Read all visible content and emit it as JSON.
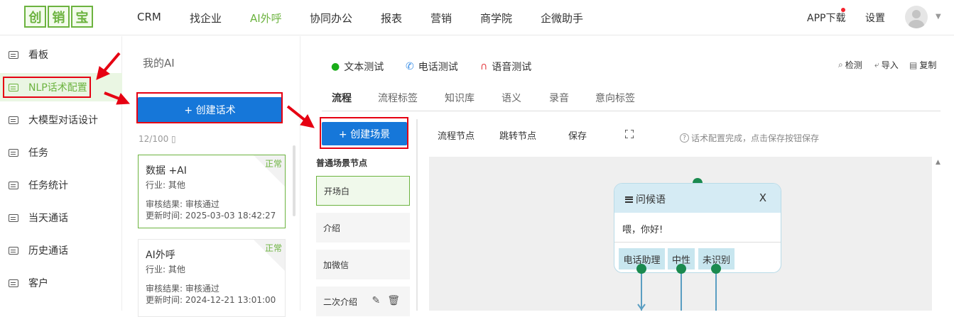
{
  "brand": {
    "logo_chars": [
      "创",
      "销",
      "宝"
    ]
  },
  "nav": {
    "items": [
      "CRM",
      "找企业",
      "AI外呼",
      "协同办公",
      "报表",
      "营销",
      "商学院",
      "企微助手"
    ],
    "active": "AI外呼",
    "app_download": "APP下载",
    "settings": "设置"
  },
  "sidebar": {
    "items": [
      "看板",
      "NLP话术配置",
      "大模型对话设计",
      "任务",
      "任务统计",
      "当天通话",
      "历史通话",
      "客户"
    ],
    "active": "NLP话术配置"
  },
  "ai_panel": {
    "title": "我的AI",
    "create_button": "+ 创建话术",
    "count": "12/100 ▯",
    "cards": [
      {
        "name": "数据 +AI",
        "status": "正常",
        "industry": "行业:  其他",
        "review": "审核结果:   审核通过",
        "updated": "更新时间:   2025-03-03 18:42:27"
      },
      {
        "name": "AI外呼",
        "status": "正常",
        "industry": "行业:  其他",
        "review": "审核结果:   审核通过",
        "updated": "更新时间:   2024-12-21 13:01:00"
      }
    ]
  },
  "tests": {
    "text_test": "文本测试",
    "phone_test": "电话测试",
    "voice_test": "语音测试"
  },
  "tools": {
    "detect": "检测",
    "import": "导入",
    "copy": "复制"
  },
  "sub_tabs": [
    "流程",
    "流程标签",
    "知识库",
    "语义",
    "录音",
    "意向标签"
  ],
  "scene": {
    "create_button": "+ 创建场景",
    "list_title": "普通场景节点",
    "nodes": [
      "开场白",
      "介绍",
      "加微信",
      "二次介绍"
    ]
  },
  "flow_toolbar": {
    "flow_node": "流程节点",
    "jump_node": "跳转节点",
    "save": "保存",
    "hint": "话术配置完成，点击保存按钮保存"
  },
  "flow_node": {
    "title": "问候语",
    "close": "X",
    "body": "喂，你好!",
    "branches": [
      "电话助理",
      "中性",
      "未识别"
    ]
  },
  "colors": {
    "accent_green": "#6cb33f",
    "primary_blue": "#1677d9",
    "annotation_red": "#e60012",
    "node_header": "#d5ebf4"
  }
}
